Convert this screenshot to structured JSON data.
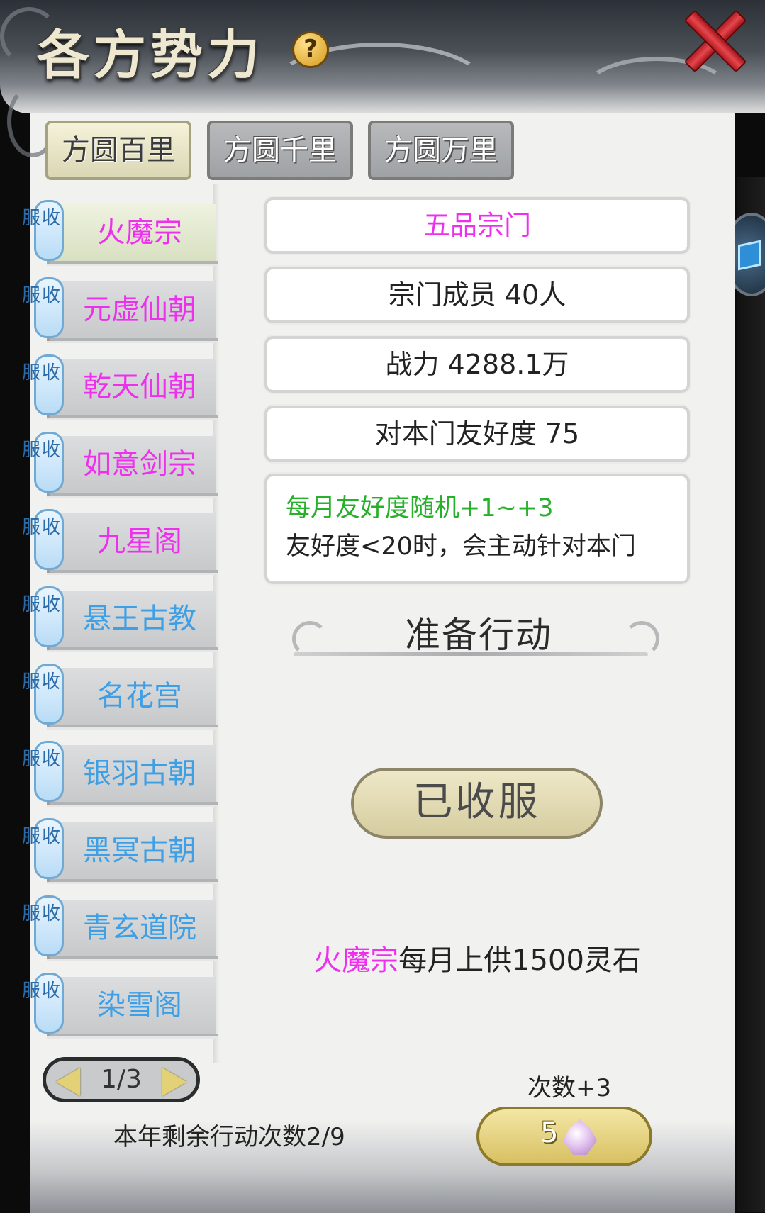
{
  "header": {
    "title": "各方势力",
    "help_symbol": "?"
  },
  "tabs": [
    {
      "label": "方圆百里",
      "active": true
    },
    {
      "label": "方圆千里",
      "active": false
    },
    {
      "label": "方圆万里",
      "active": false
    }
  ],
  "badge_text": [
    "收",
    "服"
  ],
  "sects": [
    {
      "name": "火魔宗",
      "color": "#ee30ee",
      "selected": true
    },
    {
      "name": "元虚仙朝",
      "color": "#ee30ee"
    },
    {
      "name": "乾天仙朝",
      "color": "#ee30ee"
    },
    {
      "name": "如意剑宗",
      "color": "#ee30ee"
    },
    {
      "name": "九星阁",
      "color": "#ee30ee"
    },
    {
      "name": "悬王古教",
      "color": "#3d9fe6"
    },
    {
      "name": "名花宫",
      "color": "#3d9fe6"
    },
    {
      "name": "银羽古朝",
      "color": "#3d9fe6"
    },
    {
      "name": "黑冥古朝",
      "color": "#3d9fe6"
    },
    {
      "name": "青玄道院",
      "color": "#3d9fe6"
    },
    {
      "name": "染雪阁",
      "color": "#3d9fe6"
    }
  ],
  "pager": {
    "text": "1/3"
  },
  "remaining_actions": "本年剩余行动次数2/9",
  "info": {
    "rank": "五品宗门",
    "rank_color": "#ee30ee",
    "members": "宗门成员 40人",
    "power": "战力 4288.1万",
    "friendliness": "对本门友好度 75",
    "note_green": "每月友好度随机+1~+3",
    "note_dark": "友好度<20时，会主动针对本门"
  },
  "section_header": "准备行动",
  "subdued_button": "已收服",
  "tribute": {
    "sect": "火魔宗",
    "text": "每月上供1500灵石"
  },
  "times_label": "次数+3",
  "buy_button": {
    "count": "5",
    "icon": "spirit-crystal-icon"
  }
}
